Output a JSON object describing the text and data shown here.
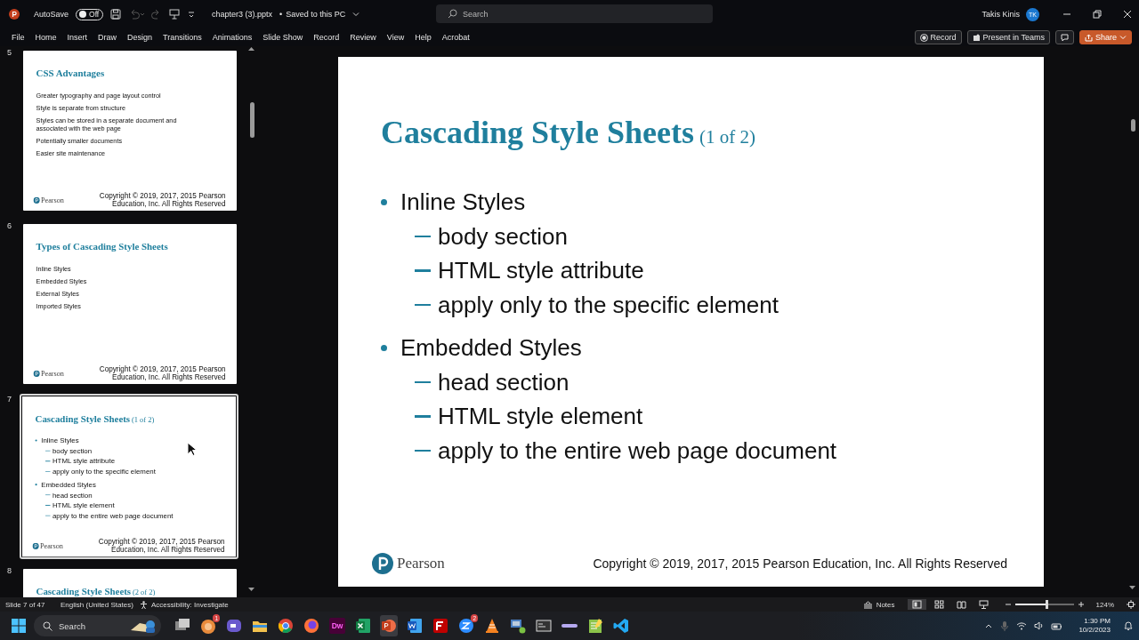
{
  "title_bar": {
    "autosave_label": "AutoSave",
    "autosave": {
      "label": "Off",
      "on": false
    },
    "file_name": "chapter3 (3).pptx",
    "separator": "•",
    "save_status": "Saved to this PC",
    "search": {
      "placeholder": "Search"
    },
    "user_name": "Takis Kinis",
    "avatar_initials": "TK"
  },
  "ribbon": {
    "tabs": [
      {
        "label": "File"
      },
      {
        "label": "Home"
      },
      {
        "label": "Insert"
      },
      {
        "label": "Draw"
      },
      {
        "label": "Design"
      },
      {
        "label": "Transitions"
      },
      {
        "label": "Animations"
      },
      {
        "label": "Slide Show"
      },
      {
        "label": "Record"
      },
      {
        "label": "Review"
      },
      {
        "label": "View"
      },
      {
        "label": "Help"
      },
      {
        "label": "Acrobat"
      }
    ],
    "actions": [
      {
        "kind": "record",
        "label": "Record"
      },
      {
        "kind": "teams",
        "label": "Present in Teams"
      },
      {
        "kind": "comments"
      },
      {
        "kind": "share",
        "label": "Share"
      }
    ]
  },
  "thumbnails": [
    {
      "number": "5",
      "selected": false,
      "slide": {
        "kind": "plain",
        "title": "CSS Advantages",
        "items": [
          {
            "text": "Greater typography and page layout control"
          },
          {
            "text": "Style is separate from structure"
          },
          {
            "text": "Styles can be stored in a separate document and associated with the web page"
          },
          {
            "text": "Potentially smaller documents"
          },
          {
            "text": "Easier site maintenance"
          }
        ],
        "footer": {
          "logo": "Pearson",
          "copyright": "Copyright © 2019, 2017, 2015 Pearson Education, Inc. All Rights Reserved"
        }
      }
    },
    {
      "number": "6",
      "selected": false,
      "slide": {
        "kind": "plain",
        "title": "Types of Cascading Style Sheets",
        "items": [
          {
            "text": "Inline Styles"
          },
          {
            "text": "Embedded Styles"
          },
          {
            "text": "External Styles"
          },
          {
            "text": "Imported Styles"
          }
        ],
        "footer": {
          "logo": "Pearson",
          "copyright": "Copyright © 2019, 2017, 2015 Pearson Education, Inc. All Rights Reserved"
        }
      }
    },
    {
      "number": "7",
      "selected": true,
      "slide": {
        "kind": "bulleted",
        "title": "Cascading Style Sheets",
        "subtitle": "(1 of 2)",
        "items": [
          {
            "text": "Inline Styles",
            "children": [
              {
                "text": "body section"
              },
              {
                "text": "HTML style attribute"
              },
              {
                "text": "apply only to the specific element"
              }
            ]
          },
          {
            "text": "Embedded Styles",
            "children": [
              {
                "text": "head section"
              },
              {
                "text": "HTML style element"
              },
              {
                "text": "apply to the entire web page document"
              }
            ]
          }
        ],
        "footer": {
          "logo": "Pearson",
          "copyright": "Copyright © 2019, 2017, 2015 Pearson Education, Inc. All Rights Reserved"
        }
      }
    },
    {
      "number": "8",
      "selected": false,
      "slide": {
        "kind": "bulleted",
        "title": "Cascading Style Sheets",
        "subtitle": "(2 of 2)"
      }
    }
  ],
  "current_slide": {
    "kind": "bulleted",
    "title": "Cascading Style Sheets",
    "subtitle": "(1 of 2)",
    "items": [
      {
        "text": "Inline Styles",
        "children": [
          {
            "text": "body section"
          },
          {
            "text": "HTML style attribute"
          },
          {
            "text": "apply only to the specific element"
          }
        ]
      },
      {
        "text": "Embedded Styles",
        "children": [
          {
            "text": "head section"
          },
          {
            "text": "HTML style element"
          },
          {
            "text": "apply to the entire web page document"
          }
        ]
      }
    ],
    "footer": {
      "logo": "Pearson",
      "copyright": "Copyright © 2019, 2017, 2015 Pearson Education, Inc. All Rights Reserved"
    }
  },
  "status_bar": {
    "slide_position": "Slide 7 of 47",
    "language": "English (United States)",
    "accessibility": "Accessibility: Investigate",
    "notes": "Notes",
    "views": [
      {
        "kind": "normal",
        "selected": true
      },
      {
        "kind": "sorter",
        "selected": false
      },
      {
        "kind": "reading",
        "selected": false
      },
      {
        "kind": "slideshow",
        "selected": false
      }
    ],
    "zoom": {
      "level": 0.55,
      "reading": "124%"
    }
  },
  "taskbar": {
    "search": {
      "placeholder": "Search"
    },
    "apps": [
      {
        "kind": "taskview",
        "active": false
      },
      {
        "kind": "badge-app",
        "badge": "1",
        "active": false
      },
      {
        "kind": "meet",
        "active": false
      },
      {
        "kind": "explorer",
        "active": false
      },
      {
        "kind": "chrome",
        "active": false
      },
      {
        "kind": "firefox",
        "active": false
      },
      {
        "kind": "dw",
        "glyph": "Dw",
        "active": false
      },
      {
        "kind": "excel",
        "active": false
      },
      {
        "kind": "powerpoint",
        "active": true
      },
      {
        "kind": "word",
        "active": false
      },
      {
        "kind": "filezilla",
        "active": false
      },
      {
        "kind": "zapp",
        "badge": "2",
        "active": false
      },
      {
        "kind": "vlc",
        "active": false
      },
      {
        "kind": "computer",
        "active": false
      },
      {
        "kind": "darkbox",
        "active": false
      },
      {
        "kind": "purplebar",
        "active": false
      },
      {
        "kind": "notepad",
        "active": false
      },
      {
        "kind": "vscode",
        "active": false
      }
    ],
    "time": "1:30 PM",
    "date": "10/2/2023"
  }
}
